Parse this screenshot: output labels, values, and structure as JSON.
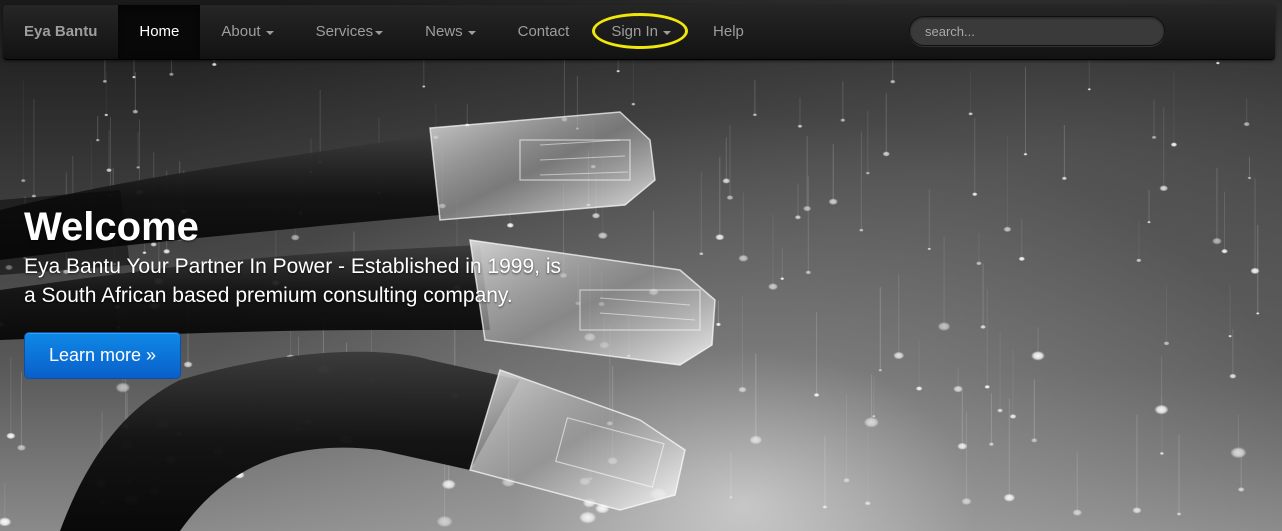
{
  "navbar": {
    "brand": "Eya Bantu",
    "items": [
      {
        "label": "Home",
        "active": true,
        "dropdown": false
      },
      {
        "label": "About",
        "active": false,
        "dropdown": true
      },
      {
        "label": "Services",
        "active": false,
        "dropdown": true
      },
      {
        "label": "News",
        "active": false,
        "dropdown": true
      },
      {
        "label": "Contact",
        "active": false,
        "dropdown": false
      },
      {
        "label": "Sign In",
        "active": false,
        "dropdown": true,
        "highlighted": true
      },
      {
        "label": "Help",
        "active": false,
        "dropdown": false
      }
    ],
    "search": {
      "placeholder": "search..."
    }
  },
  "hero": {
    "title": "Welcome",
    "subtitle_line1": "Eya Bantu Your Partner In Power - Established in 1999, is",
    "subtitle_line2": "a South African based premium consulting company.",
    "cta_label": "Learn more »"
  },
  "colors": {
    "navbar_bg": "#1b1b1b",
    "nav_text": "#9d9d9d",
    "active_text": "#ffffff",
    "highlight_ring": "#f2e70b",
    "cta_bg": "#0a6fd6"
  }
}
